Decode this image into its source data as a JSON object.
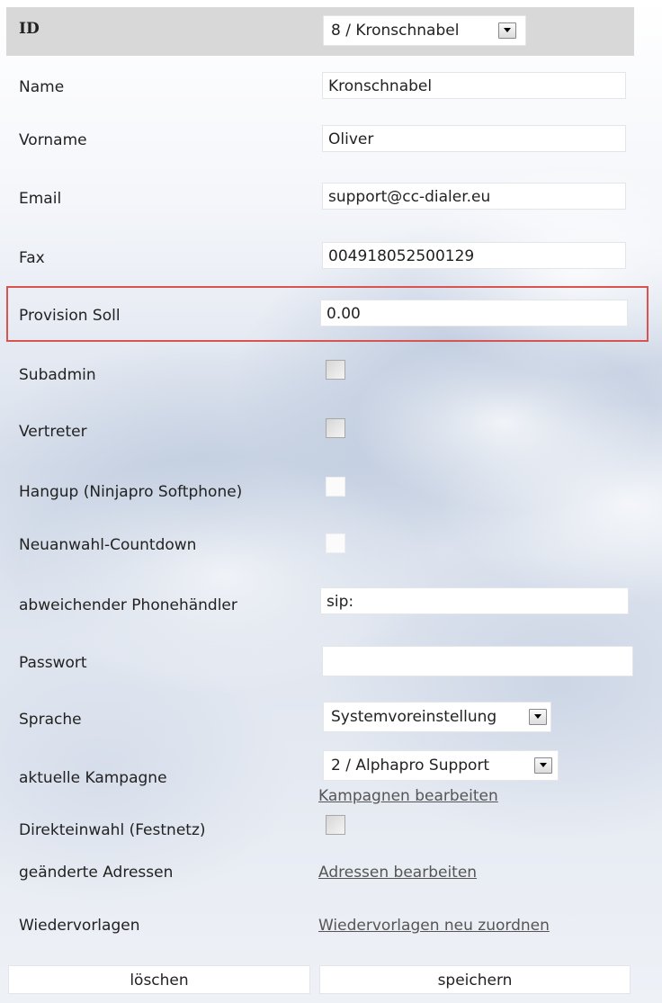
{
  "id_row": {
    "label": "ID",
    "selected": "8 / Kronschnabel"
  },
  "fields": {
    "name": {
      "label": "Name",
      "value": "Kronschnabel"
    },
    "vorname": {
      "label": "Vorname",
      "value": "Oliver"
    },
    "email": {
      "label": "Email",
      "value": "support@cc-dialer.eu"
    },
    "fax": {
      "label": "Fax",
      "value": "004918052500129"
    },
    "provision_soll": {
      "label": "Provision Soll",
      "value": "0.00"
    },
    "subadmin": {
      "label": "Subadmin",
      "checked": false
    },
    "vertreter": {
      "label": "Vertreter",
      "checked": false
    },
    "hangup": {
      "label": "Hangup (Ninjapro Softphone)",
      "checked": false
    },
    "neuanwahl": {
      "label": "Neuanwahl-Countdown",
      "checked": false
    },
    "phonehaendler": {
      "label": "abweichender Phonehändler",
      "value": "sip:"
    },
    "passwort": {
      "label": "Passwort",
      "value": ""
    },
    "sprache": {
      "label": "Sprache",
      "selected": "Systemvoreinstellung"
    },
    "kampagne": {
      "label": "aktuelle Kampagne",
      "selected": "2 / Alphapro Support",
      "link": "Kampagnen bearbeiten"
    },
    "direkteinwahl": {
      "label": "Direkteinwahl (Festnetz)",
      "checked": false
    },
    "adressen": {
      "label": "geänderte Adressen",
      "link": "Adressen bearbeiten"
    },
    "wiedervorlagen": {
      "label": "Wiedervorlagen",
      "link": "Wiedervorlagen neu zuordnen"
    }
  },
  "buttons": {
    "delete": "löschen",
    "save": "speichern"
  },
  "colors": {
    "header_bg": "#d8d8d8",
    "highlight_border": "#d9534f"
  }
}
